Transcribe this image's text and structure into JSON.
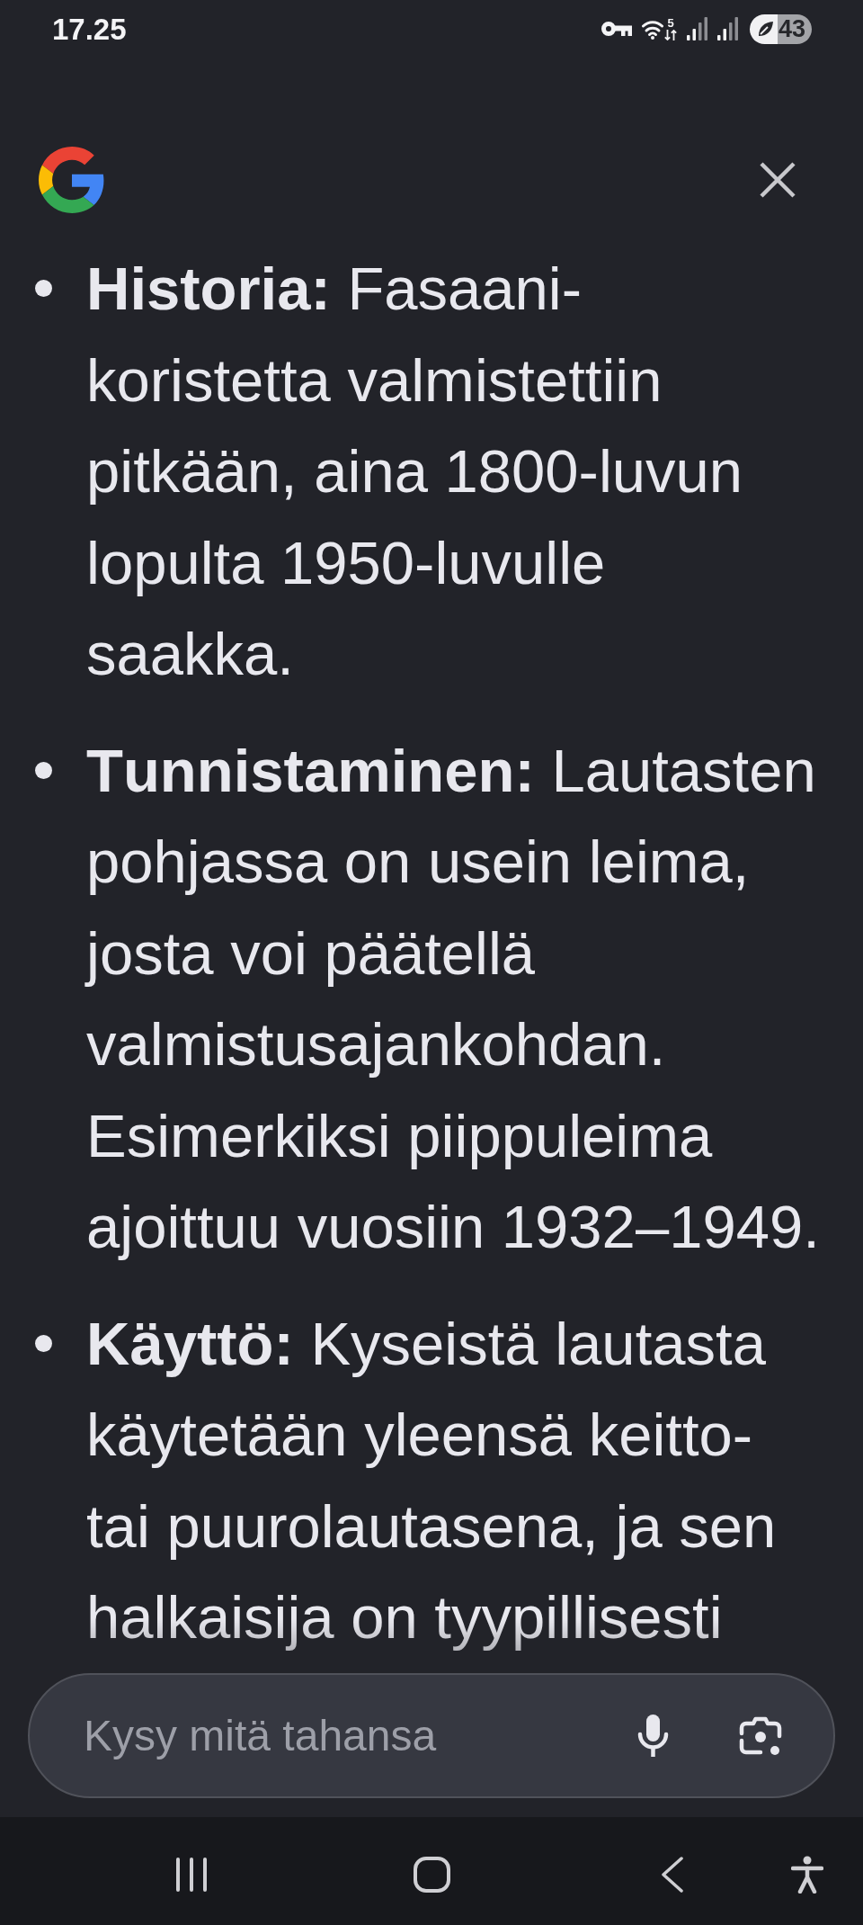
{
  "status_bar": {
    "time": "17.25",
    "wifi_label": "5",
    "battery": "43"
  },
  "answer": {
    "items": [
      {
        "text": "**Historia:** Fasaani-koristetta valmistettiin pitkään, aina 1800-luvun lopulta 1950-luvulle saakka."
      },
      {
        "text": "**Tunnistaminen:** Lautasten pohjassa on usein leima, josta voi päätellä valmistusajankohdan. Esimerkiksi piippuleima ajoittuu vuosiin 1932–1949."
      },
      {
        "text": "**Käyttö:** Kyseistä lautasta käytetään yleensä keitto- tai puurolautasena, ja sen halkaisija on tyypillisesti"
      }
    ]
  },
  "prompt_bar": {
    "placeholder": "Kysy mitä tahansa"
  }
}
